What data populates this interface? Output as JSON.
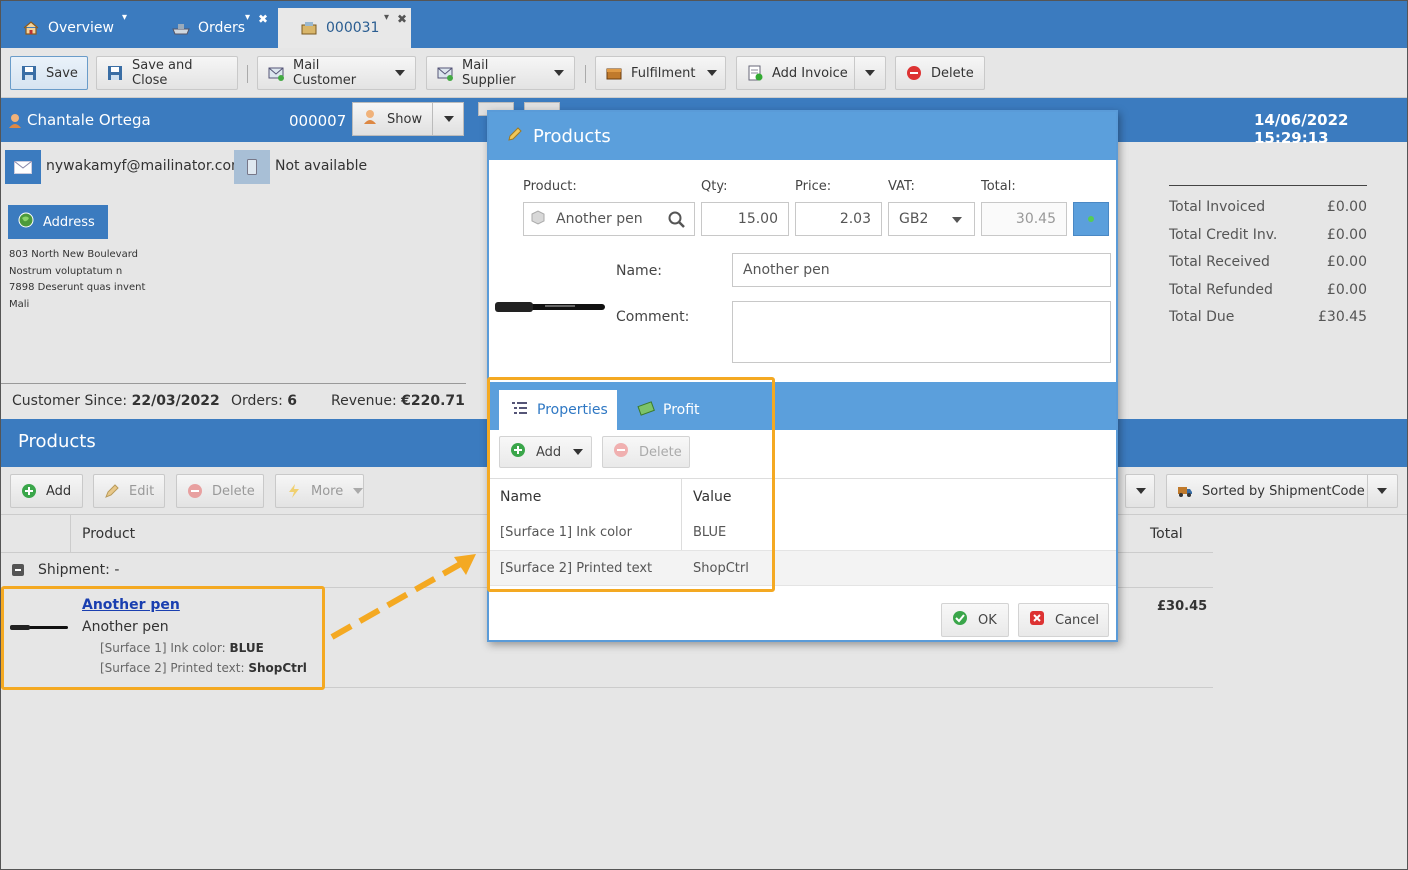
{
  "tabs": [
    {
      "label": "Overview",
      "icon": "home-icon"
    },
    {
      "label": "Orders",
      "icon": "orders-icon"
    },
    {
      "label": "000031",
      "icon": "order-detail-icon"
    }
  ],
  "toolbar": {
    "save": "Save",
    "save_close": "Save and Close",
    "mail_customer": "Mail Customer",
    "mail_supplier": "Mail Supplier",
    "fulfilment": "Fulfilment",
    "add_invoice": "Add Invoice",
    "delete": "Delete"
  },
  "customer": {
    "name": "Chantale Ortega",
    "number": "000007",
    "show": "Show",
    "datetime": "14/06/2022 15:29:13",
    "email": "nywakamyf@mailinator.com",
    "phone": "Not available",
    "address_button": "Address",
    "address_lines": [
      "803 North New Boulevard",
      "Nostrum voluptatum n",
      "7898 Deserunt quas invent",
      "Mali"
    ],
    "since_label": "Customer Since:",
    "since_value": "22/03/2022",
    "orders_label": "Orders:",
    "orders_value": "6",
    "revenue_label": "Revenue:",
    "revenue_value": "€220.71"
  },
  "totals": [
    {
      "label": "Total Invoiced",
      "value": "£0.00"
    },
    {
      "label": "Total Credit Inv.",
      "value": "£0.00"
    },
    {
      "label": "Total Received",
      "value": "£0.00"
    },
    {
      "label": "Total Refunded",
      "value": "£0.00"
    },
    {
      "label": "Total Due",
      "value": "£30.45"
    }
  ],
  "products_section": {
    "title": "Products",
    "add": "Add",
    "edit": "Edit",
    "delete": "Delete",
    "more": "More",
    "sorted": "Sorted by ShipmentCode",
    "col_product": "Product",
    "col_total": "Total",
    "shipment": "Shipment: -",
    "item": {
      "link": "Another pen",
      "name": "Another pen",
      "prop1_label": "[Surface 1] Ink color:",
      "prop1_value": "BLUE",
      "prop2_label": "[Surface 2] Printed text:",
      "prop2_value": "ShopCtrl",
      "total": "£30.45"
    }
  },
  "modal": {
    "title": "Products",
    "product_label": "Product:",
    "qty_label": "Qty:",
    "price_label": "Price:",
    "vat_label": "VAT:",
    "total_label": "Total:",
    "product_value": "Another pen",
    "qty_value": "15.00",
    "price_value": "2.03",
    "vat_value": "GB2",
    "total_value": "30.45",
    "name_label": "Name:",
    "name_value": "Another pen",
    "comment_label": "Comment:",
    "tab_properties": "Properties",
    "tab_profit": "Profit",
    "add": "Add",
    "delete": "Delete",
    "col_name": "Name",
    "col_value": "Value",
    "rows": [
      {
        "name": "[Surface 1] Ink color",
        "value": "BLUE"
      },
      {
        "name": "[Surface 2] Printed text",
        "value": "ShopCtrl"
      }
    ],
    "ok": "OK",
    "cancel": "Cancel"
  },
  "colors": {
    "header_blue": "#3b7bbf",
    "modal_blue": "#5b9fdc",
    "highlight": "#f4a922"
  }
}
